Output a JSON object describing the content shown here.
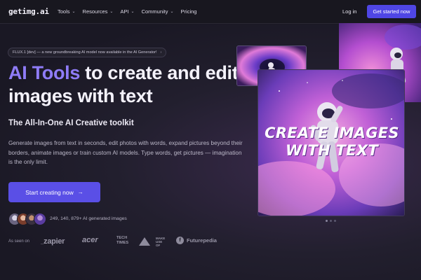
{
  "nav": {
    "logo": "getimg.ai",
    "links": [
      {
        "label": "Tools",
        "dropdown": true
      },
      {
        "label": "Resources",
        "dropdown": true
      },
      {
        "label": "API",
        "dropdown": true
      },
      {
        "label": "Community",
        "dropdown": true
      },
      {
        "label": "Pricing",
        "dropdown": false
      }
    ],
    "login": "Log in",
    "cta": "Get started now"
  },
  "hero": {
    "announcement": "FLUX.1 [dev] — a new groundbreaking AI model now available in the AI Generator!",
    "headline_accent": "AI Tools",
    "headline_rest": " to create and edit images with text",
    "subhead": "The All-In-One AI Creative toolkit",
    "description": "Generate images from text in seconds, edit photos with words, expand pictures beyond their borders, animate images or train custom AI models. Type words, get pictures — imagination is the only limit.",
    "cta": "Start creating now",
    "social_proof": "249, 140, 879+ AI generated images",
    "as_seen_on": "As seen on",
    "brands": [
      "zapier",
      "acer",
      "TECH TIMES",
      "MAKE USE OF",
      "Futurepedia"
    ]
  },
  "showcase": {
    "overlay_text": [
      "CREATE IMAGES",
      "WITH TEXT"
    ],
    "carousel_active_index": 0,
    "carousel_count": 3
  },
  "colors": {
    "accent": "#8f7cf7",
    "button": "#4f46e5",
    "background": "#1a1824"
  }
}
